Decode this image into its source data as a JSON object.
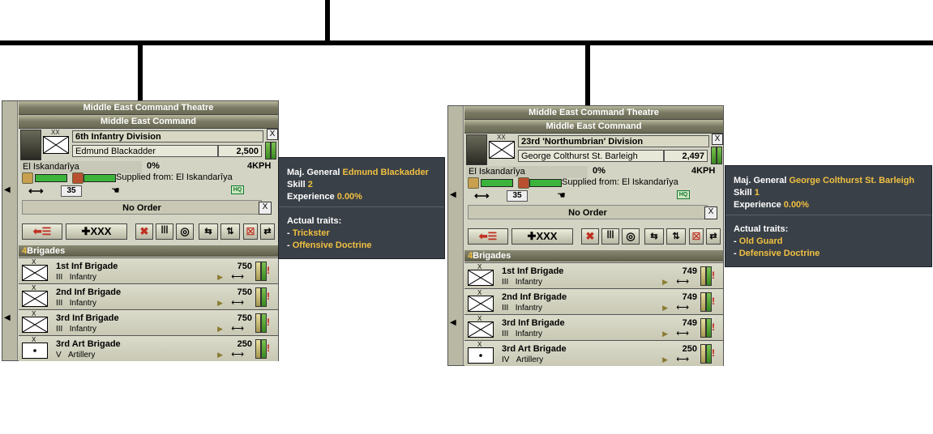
{
  "colors": {
    "tree_line": "#000000",
    "highlight": "#f0c040",
    "tooltip_bg": "#3a4048",
    "panel_bg": "#d4d4c4"
  },
  "left": {
    "theatre": "Middle East Command Theatre",
    "command": "Middle East Command",
    "division": "6th Infantry Division",
    "echelon": "XX",
    "commander": "Edmund Blackadder",
    "strength": "2,500",
    "location": "El Iskandarîya",
    "percent": "0%",
    "speed": "4KPH",
    "supplied": "Supplied from: El Iskandarîya",
    "small_value": "35",
    "hq_label": "HQ",
    "order": "No Order",
    "close_glyph": "X",
    "btn_xxx": "XXX",
    "brigades_count": "4",
    "brigades_label": "Brigades",
    "brigades": [
      {
        "echelon": "X",
        "name": "1st Inf Brigade",
        "size": "III",
        "type": "Infantry",
        "strength": "750",
        "symbol": "infantry"
      },
      {
        "echelon": "X",
        "name": "2nd Inf Brigade",
        "size": "III",
        "type": "Infantry",
        "strength": "750",
        "symbol": "infantry"
      },
      {
        "echelon": "X",
        "name": "3rd Inf Brigade",
        "size": "III",
        "type": "Infantry",
        "strength": "750",
        "symbol": "infantry"
      },
      {
        "echelon": "X",
        "name": "3rd Art Brigade",
        "size": "V",
        "type": "Artillery",
        "strength": "250",
        "symbol": "artillery"
      }
    ],
    "tooltip": {
      "rank": "Maj. General",
      "name": "Edmund Blackadder",
      "skill_label": "Skill",
      "skill": "2",
      "exp_label": "Experience",
      "exp": "0.00%",
      "traits_label": "Actual traits:",
      "traits": [
        "Trickster",
        "Offensive Doctrine"
      ]
    }
  },
  "right": {
    "theatre": "Middle East Command Theatre",
    "command": "Middle East Command",
    "division": "23rd 'Northumbrian' Division",
    "echelon": "XX",
    "commander": "George Colthurst St. Barleigh",
    "strength": "2,497",
    "location": "El Iskandarîya",
    "percent": "0%",
    "speed": "4KPH",
    "supplied": "Supplied from: El Iskandarîya",
    "small_value": "35",
    "hq_label": "HQ",
    "order": "No Order",
    "close_glyph": "X",
    "btn_xxx": "XXX",
    "brigades_count": "4",
    "brigades_label": "Brigades",
    "brigades": [
      {
        "echelon": "X",
        "name": "1st Inf Brigade",
        "size": "III",
        "type": "Infantry",
        "strength": "749",
        "symbol": "infantry"
      },
      {
        "echelon": "X",
        "name": "2nd Inf Brigade",
        "size": "III",
        "type": "Infantry",
        "strength": "749",
        "symbol": "infantry"
      },
      {
        "echelon": "X",
        "name": "3rd Inf Brigade",
        "size": "III",
        "type": "Infantry",
        "strength": "749",
        "symbol": "infantry"
      },
      {
        "echelon": "X",
        "name": "3rd Art Brigade",
        "size": "IV",
        "type": "Artillery",
        "strength": "250",
        "symbol": "artillery"
      }
    ],
    "tooltip": {
      "rank": "Maj. General",
      "name": "George Colthurst St. Barleigh",
      "skill_label": "Skill",
      "skill": "1",
      "exp_label": "Experience",
      "exp": "0.00%",
      "traits_label": "Actual traits:",
      "traits": [
        "Old Guard",
        "Defensive Doctrine"
      ]
    }
  }
}
